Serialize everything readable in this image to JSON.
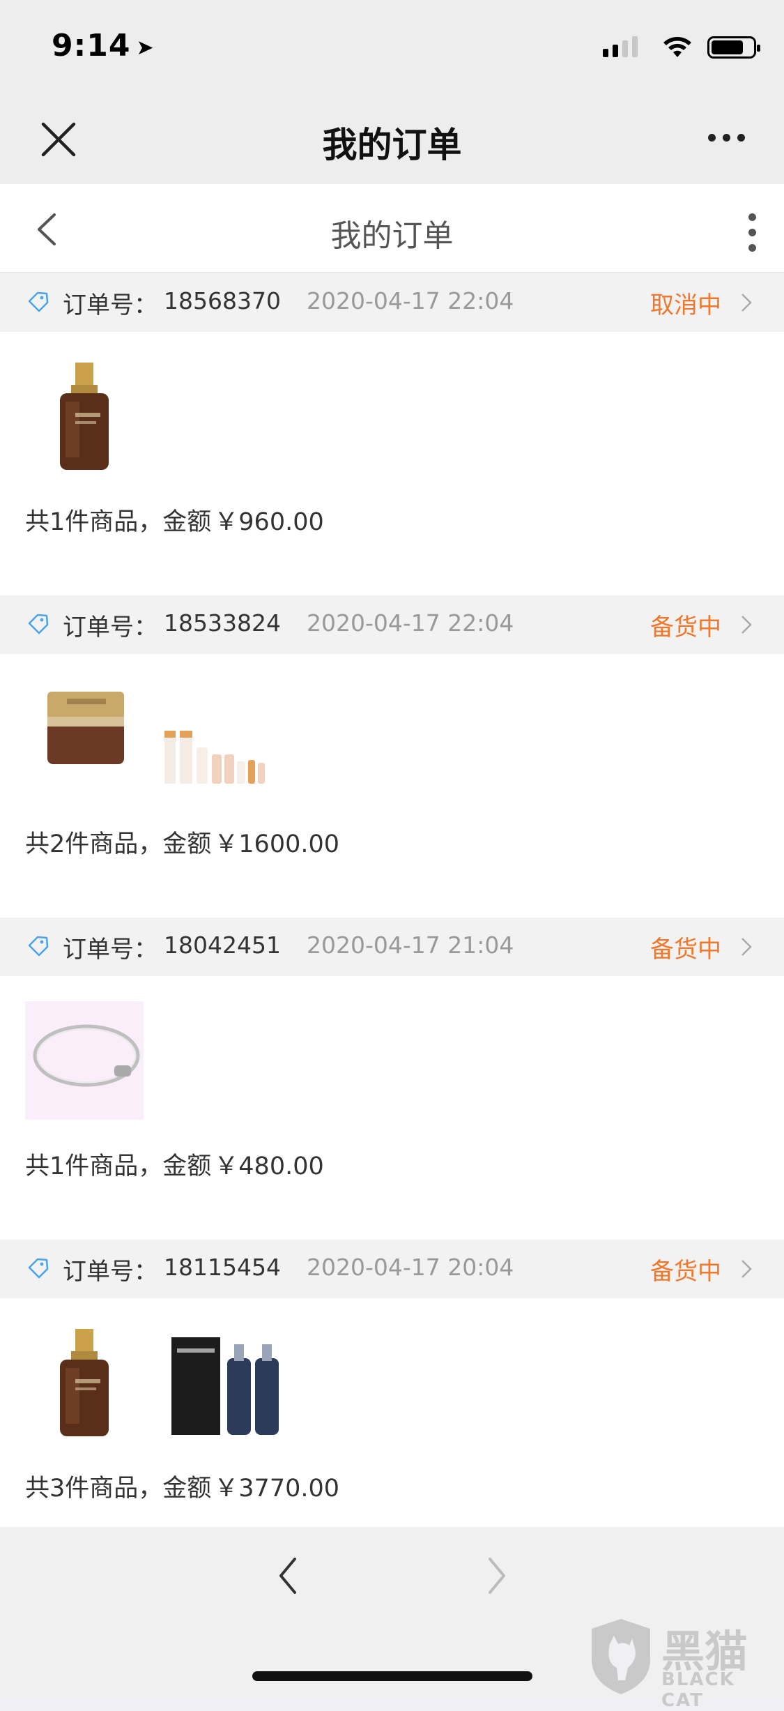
{
  "status_bar": {
    "time": "9:14"
  },
  "wechat_bar": {
    "title": "我的订单"
  },
  "nav_bar": {
    "title": "我的订单"
  },
  "orders": [
    {
      "label": "订单号：",
      "number": "18568370",
      "date": "2020-04-17 22:04",
      "status": "取消中",
      "products": [
        "serum-bottle"
      ],
      "summary": "共1件商品，金额",
      "amount": "￥960.00"
    },
    {
      "label": "订单号：",
      "number": "18533824",
      "date": "2020-04-17 22:04",
      "status": "备货中",
      "products": [
        "cream-jar",
        "skincare-set"
      ],
      "summary": "共2件商品，金额",
      "amount": "￥1600.00"
    },
    {
      "label": "订单号：",
      "number": "18042451",
      "date": "2020-04-17 21:04",
      "status": "备货中",
      "products": [
        "silver-bracelet"
      ],
      "summary": "共1件商品，金额",
      "amount": "￥480.00"
    },
    {
      "label": "订单号：",
      "number": "18115454",
      "date": "2020-04-17 20:04",
      "status": "备货中",
      "products": [
        "serum-bottle",
        "lancome-box-set"
      ],
      "summary": "共3件商品，金额",
      "amount": "￥3770.00"
    }
  ],
  "watermark": {
    "text": "黑猫",
    "sub": "BLACK CAT"
  },
  "colors": {
    "status": "#f0782c",
    "header_bg": "#f2f2f2",
    "tag_icon": "#4aa3e8"
  }
}
